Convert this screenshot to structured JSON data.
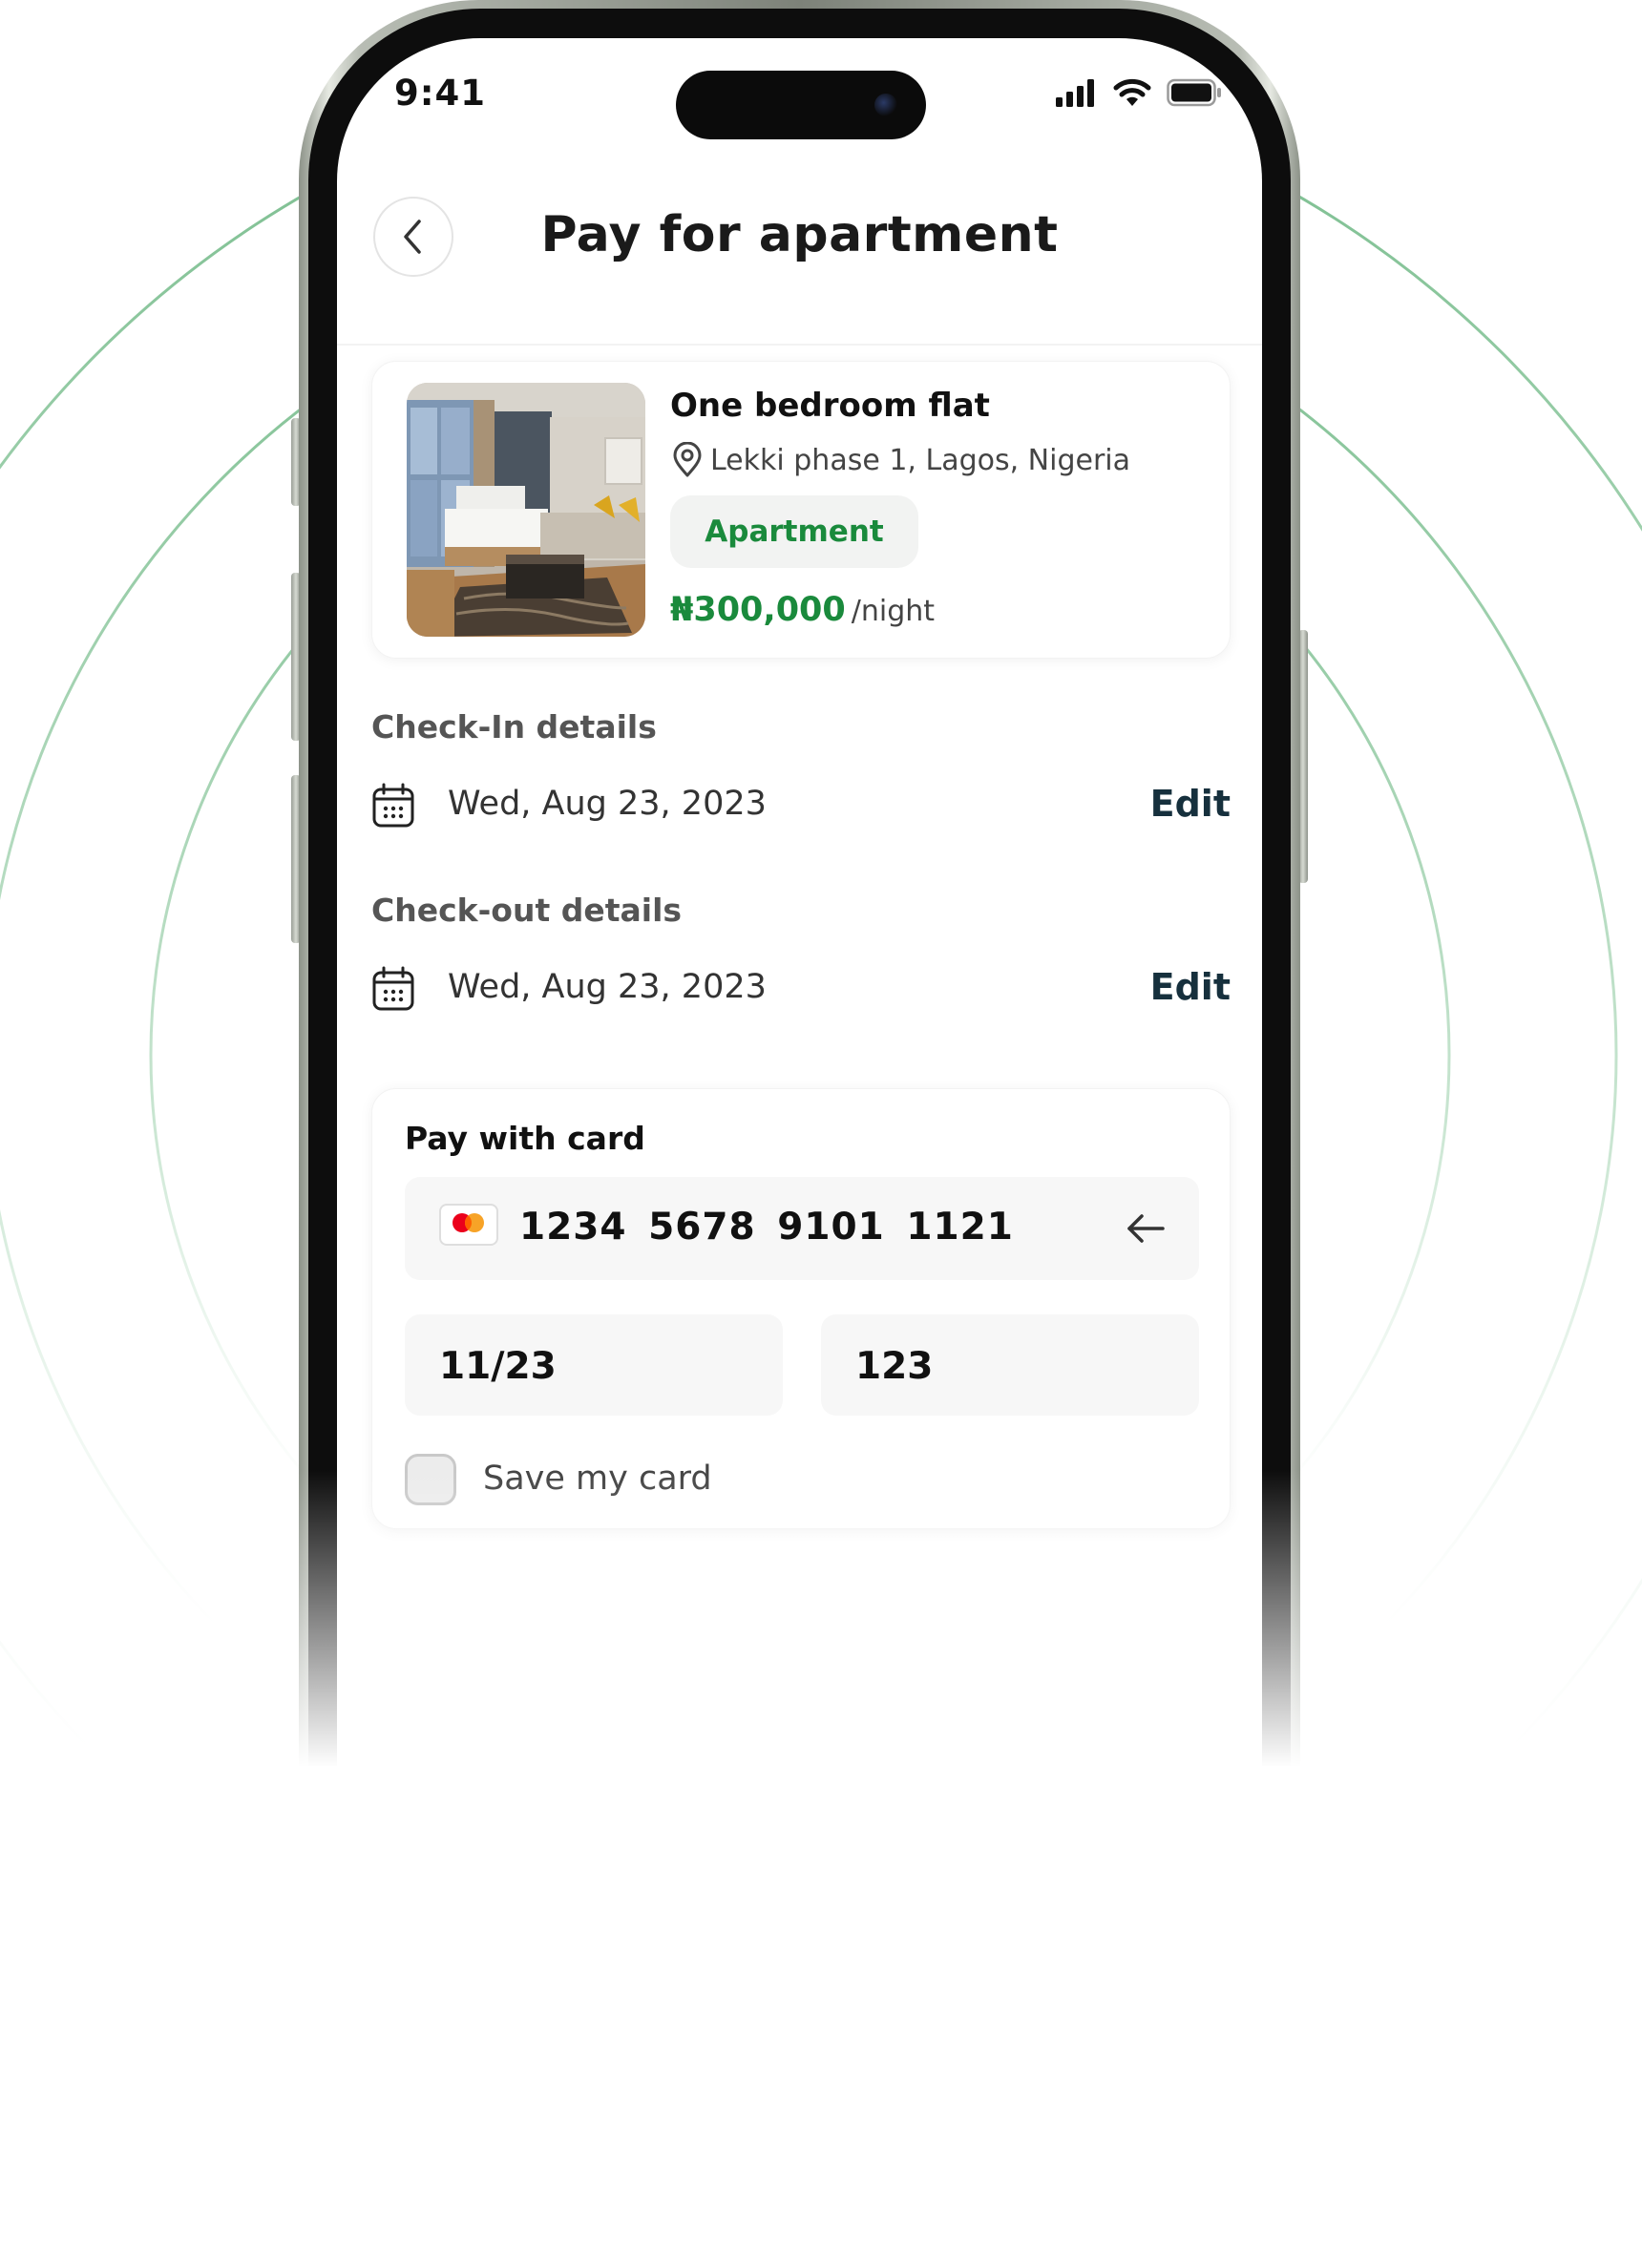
{
  "colors": {
    "accent_green": "#1a8a3c",
    "edit_link": "#16303d",
    "ring": "#7fbf91"
  },
  "status_bar": {
    "time": "9:41",
    "icons": [
      "cellular-signal-icon",
      "wifi-icon",
      "battery-icon"
    ]
  },
  "header": {
    "back_icon": "chevron-left-icon",
    "title": "Pay for apartment"
  },
  "listing": {
    "title": "One bedroom flat",
    "location": "Lekki phase 1, Lagos, Nigeria",
    "location_icon": "location-pin-icon",
    "tag": "Apartment",
    "price": "₦300,000",
    "price_unit": "/night"
  },
  "check_in": {
    "label": "Check-In details",
    "date": "Wed, Aug 23, 2023",
    "edit_label": "Edit"
  },
  "check_out": {
    "label": "Check-out details",
    "date": "Wed, Aug 23, 2023",
    "edit_label": "Edit"
  },
  "payment": {
    "title": "Pay with card",
    "card_brand_icon": "mastercard-icon",
    "card_number": "1234 5678 9101 1121",
    "expiry": "11/23",
    "cvv": "123",
    "save_card_label": "Save my card",
    "save_card_checked": false
  }
}
